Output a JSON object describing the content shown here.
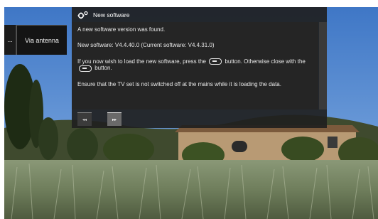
{
  "source_bar": {
    "more_label": "...",
    "current_source": "Via antenna"
  },
  "dialog": {
    "title": "New software",
    "title_icon": "gear-icon",
    "message_found": "A new software version was found.",
    "version_line": "New software:  V4.4.40.0   (Current software:  V4.4.31.0)",
    "instruction_part1": "If you now wish to load the new software, press the",
    "instruction_part2": "button. Otherwise close with the",
    "instruction_part3": "button.",
    "warning": "Ensure that the TV set is not switched off at the mains while it is loading the data.",
    "key_play_icon": "play-key-icon",
    "key_back_icon": "back-key-icon",
    "nav_left_label": "◂◂",
    "nav_right_label": "▸▸"
  }
}
